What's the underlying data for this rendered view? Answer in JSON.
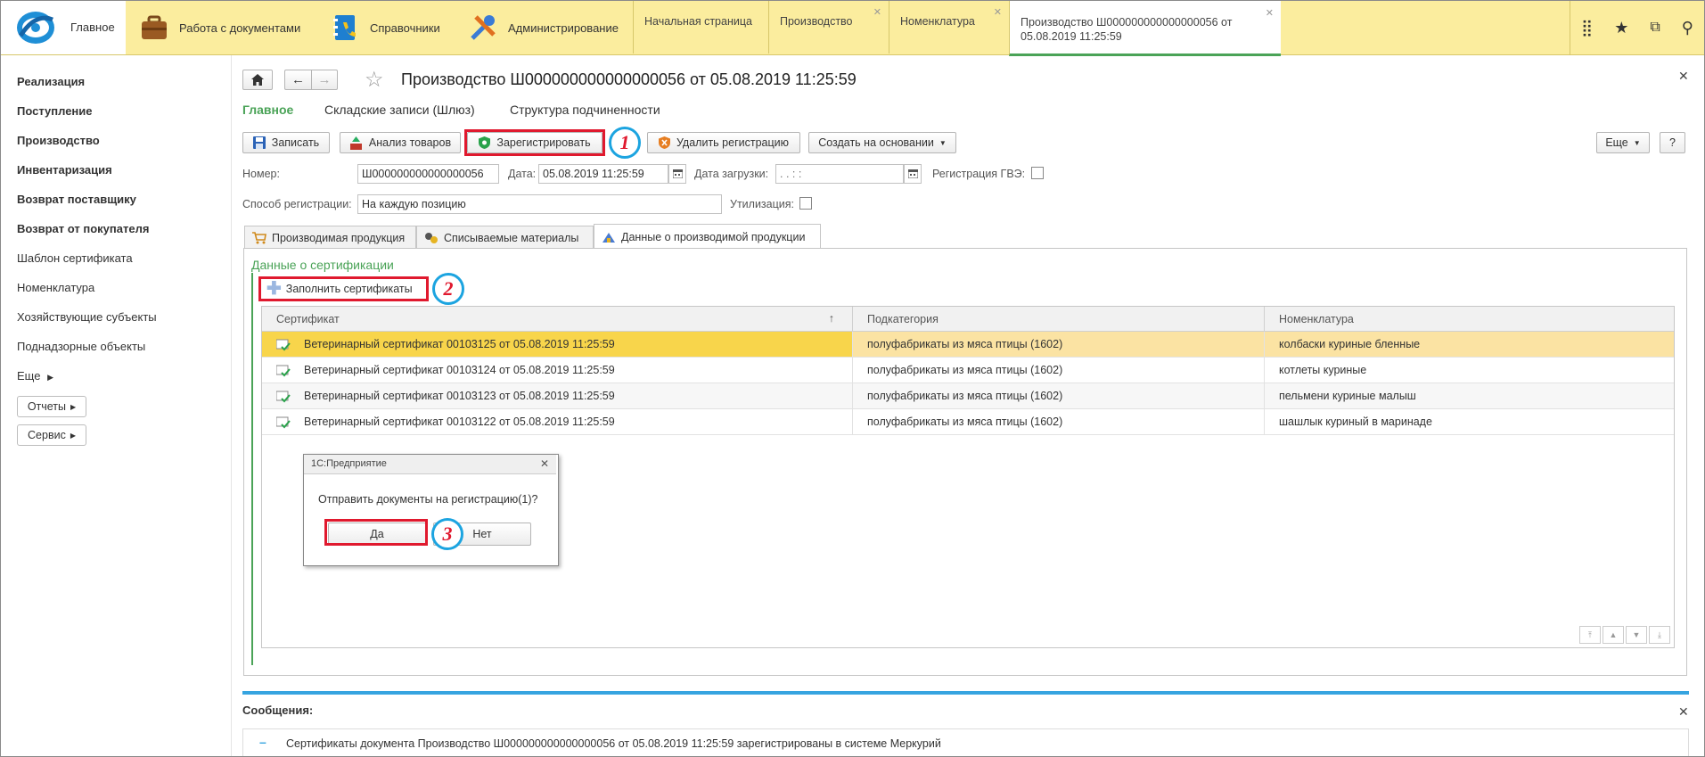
{
  "topbar": {
    "home_label": "Главное",
    "sections": [
      {
        "label": "Работа с документами",
        "icon": "briefcase-icon"
      },
      {
        "label": "Справочники",
        "icon": "address-book-icon"
      },
      {
        "label": "Администрирование",
        "icon": "tools-icon"
      }
    ],
    "open_tabs": [
      {
        "label": "Начальная страница",
        "closable": false
      },
      {
        "label": "Производство",
        "closable": true
      },
      {
        "label": "Номенклатура",
        "closable": true
      },
      {
        "label_line1": "Производство Ш000000000000000056 от",
        "label_line2": "05.08.2019 11:25:59",
        "closable": true,
        "active": true
      }
    ],
    "right_icons": [
      "grid-icon",
      "star-icon",
      "history-icon",
      "search-icon"
    ]
  },
  "sidebar": {
    "items": [
      {
        "label": "Реализация",
        "bold": true
      },
      {
        "label": "Поступление",
        "bold": true
      },
      {
        "label": "Производство",
        "bold": true
      },
      {
        "label": "Инвентаризация",
        "bold": true
      },
      {
        "label": "Возврат поставщику",
        "bold": true
      },
      {
        "label": "Возврат от покупателя",
        "bold": true
      },
      {
        "label": "Шаблон сертификата",
        "bold": false
      },
      {
        "label": "Номенклатура",
        "bold": false
      },
      {
        "label": "Хозяйствующие субъекты",
        "bold": false
      },
      {
        "label": "Поднадзорные объекты",
        "bold": false
      },
      {
        "label": "Еще",
        "bold": false
      }
    ],
    "reports_button": "Отчеты",
    "service_button": "Сервис"
  },
  "document": {
    "title": "Производство Ш000000000000000056 от 05.08.2019 11:25:59",
    "nav_links": [
      "Главное",
      "Складские записи (Шлюз)",
      "Структура подчиненности"
    ],
    "toolbar": {
      "save": "Записать",
      "analysis": "Анализ товаров",
      "register": "Зарегистрировать",
      "unregister": "Удалить регистрацию",
      "create_based": "Создать на основании",
      "more": "Еще",
      "help": "?"
    },
    "fields": {
      "number_label": "Номер:",
      "number_value": "Ш000000000000000056",
      "date_label": "Дата:",
      "date_value": "05.08.2019 11:25:59",
      "load_date_label": "Дата загрузки:",
      "load_date_value": ". .     : :",
      "gve_label": "Регистрация ГВЭ:",
      "reg_method_label": "Способ регистрации:",
      "reg_method_value": "На каждую позицию",
      "disposal_label": "Утилизация:"
    },
    "form_tabs": [
      "Производимая продукция",
      "Списываемые материалы",
      "Данные о производимой продукции"
    ],
    "cert_section_title": "Данные о сертификации",
    "fill_button": "Заполнить сертификаты",
    "grid": {
      "columns": [
        "Сертификат",
        "Подкатегория",
        "Номенклатура"
      ],
      "sort_indicator": "↑",
      "rows": [
        {
          "cert": "Ветеринарный сертификат 00103125 от 05.08.2019 11:25:59",
          "subcategory": "полуфабрикаты из мяса птицы (1602)",
          "nomenclature": "колбаски куриные бленные"
        },
        {
          "cert": "Ветеринарный сертификат 00103124 от 05.08.2019 11:25:59",
          "subcategory": "полуфабрикаты из мяса птицы (1602)",
          "nomenclature": "котлеты куриные"
        },
        {
          "cert": "Ветеринарный сертификат 00103123 от 05.08.2019 11:25:59",
          "subcategory": "полуфабрикаты из мяса птицы (1602)",
          "nomenclature": "пельмени куриные малыш"
        },
        {
          "cert": "Ветеринарный сертификат 00103122 от 05.08.2019 11:25:59",
          "subcategory": "полуфабрикаты из мяса птицы (1602)",
          "nomenclature": "шашлык куриный в маринаде"
        }
      ]
    }
  },
  "dialog": {
    "title": "1С:Предприятие",
    "message": "Отправить документы на регистрацию(1)?",
    "yes": "Да",
    "no": "Нет"
  },
  "annotations": {
    "step1": "1",
    "step2": "2",
    "step3": "3"
  },
  "messages": {
    "title": "Сообщения:",
    "text": "Сертификаты документа Производство Ш000000000000000056 от 05.08.2019 11:25:59 зарегистрированы в системе Меркурий"
  },
  "colors": {
    "accent_green": "#4aa357",
    "highlight_red": "#e0192e",
    "callout_blue": "#1ca4e0",
    "topbar_yellow": "#fbed9e",
    "selected_row": "#f8d54b"
  }
}
